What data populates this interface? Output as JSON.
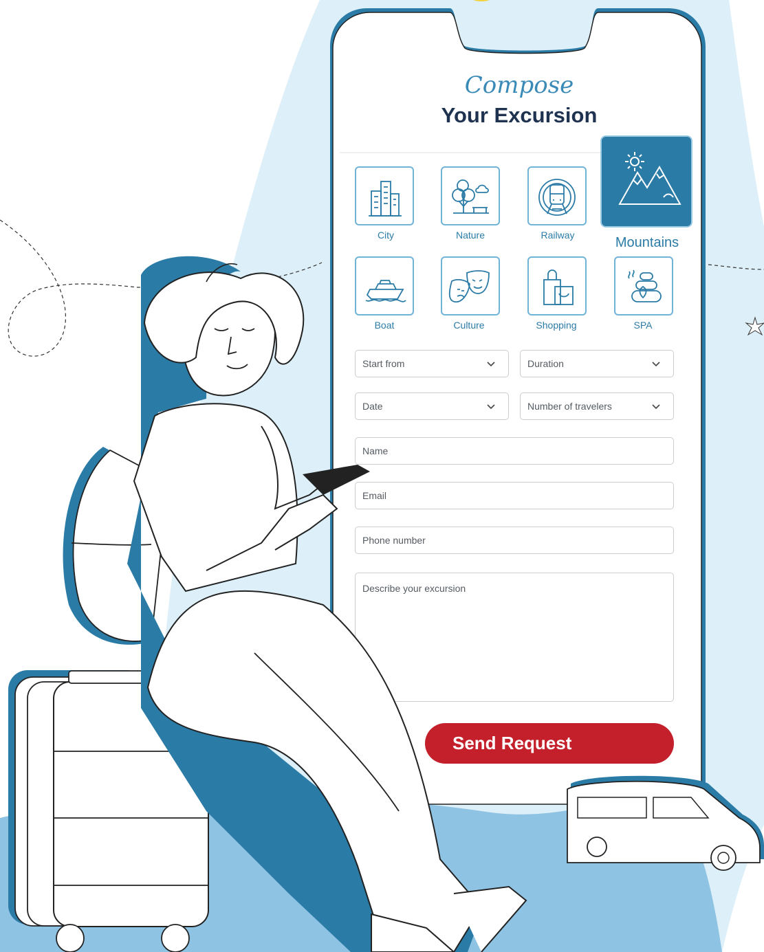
{
  "header": {
    "title_script": "Compose",
    "title_main": "Your Excursion"
  },
  "categories": [
    {
      "label": "City",
      "icon": "city-buildings-icon"
    },
    {
      "label": "Nature",
      "icon": "nature-trees-icon"
    },
    {
      "label": "Railway",
      "icon": "train-icon"
    },
    {
      "label": "Mountains",
      "icon": "mountains-sun-icon",
      "selected": true
    },
    {
      "label": "Boat",
      "icon": "boat-icon"
    },
    {
      "label": "Culture",
      "icon": "theater-masks-icon"
    },
    {
      "label": "Shopping",
      "icon": "shopping-bags-icon"
    },
    {
      "label": "SPA",
      "icon": "spa-stones-icon"
    }
  ],
  "form": {
    "start_from": "Start from",
    "duration": "Duration",
    "date": "Date",
    "travelers": "Number of travelers",
    "name": "Name",
    "email": "Email",
    "phone": "Phone number",
    "description": "Describe your excursion",
    "submit": "Send Request"
  },
  "colors": {
    "accent": "#2b7ba7",
    "light_blue": "#ddeff8",
    "submit": "#c3202b",
    "title_dark": "#1f3350"
  }
}
